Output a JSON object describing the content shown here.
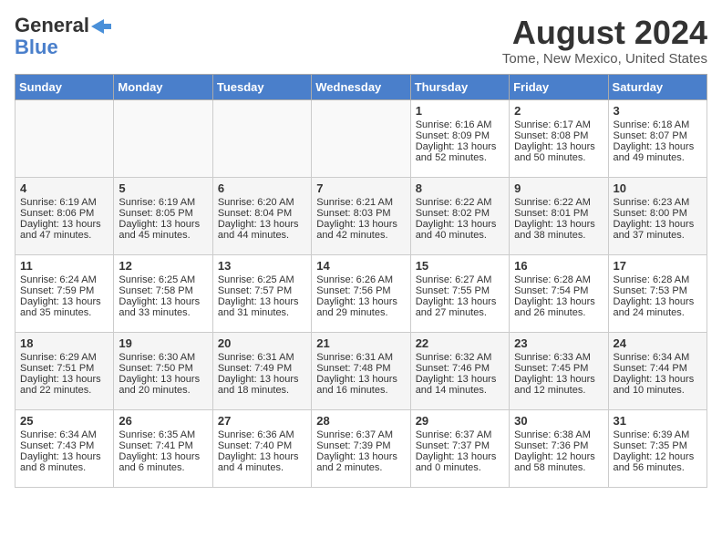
{
  "logo": {
    "line1": "General",
    "line2": "Blue"
  },
  "title": "August 2024",
  "location": "Tome, New Mexico, United States",
  "days_header": [
    "Sunday",
    "Monday",
    "Tuesday",
    "Wednesday",
    "Thursday",
    "Friday",
    "Saturday"
  ],
  "weeks": [
    [
      {
        "day": "",
        "info": ""
      },
      {
        "day": "",
        "info": ""
      },
      {
        "day": "",
        "info": ""
      },
      {
        "day": "",
        "info": ""
      },
      {
        "day": "1",
        "sunrise": "Sunrise: 6:16 AM",
        "sunset": "Sunset: 8:09 PM",
        "daylight": "Daylight: 13 hours and 52 minutes."
      },
      {
        "day": "2",
        "sunrise": "Sunrise: 6:17 AM",
        "sunset": "Sunset: 8:08 PM",
        "daylight": "Daylight: 13 hours and 50 minutes."
      },
      {
        "day": "3",
        "sunrise": "Sunrise: 6:18 AM",
        "sunset": "Sunset: 8:07 PM",
        "daylight": "Daylight: 13 hours and 49 minutes."
      }
    ],
    [
      {
        "day": "4",
        "sunrise": "Sunrise: 6:19 AM",
        "sunset": "Sunset: 8:06 PM",
        "daylight": "Daylight: 13 hours and 47 minutes."
      },
      {
        "day": "5",
        "sunrise": "Sunrise: 6:19 AM",
        "sunset": "Sunset: 8:05 PM",
        "daylight": "Daylight: 13 hours and 45 minutes."
      },
      {
        "day": "6",
        "sunrise": "Sunrise: 6:20 AM",
        "sunset": "Sunset: 8:04 PM",
        "daylight": "Daylight: 13 hours and 44 minutes."
      },
      {
        "day": "7",
        "sunrise": "Sunrise: 6:21 AM",
        "sunset": "Sunset: 8:03 PM",
        "daylight": "Daylight: 13 hours and 42 minutes."
      },
      {
        "day": "8",
        "sunrise": "Sunrise: 6:22 AM",
        "sunset": "Sunset: 8:02 PM",
        "daylight": "Daylight: 13 hours and 40 minutes."
      },
      {
        "day": "9",
        "sunrise": "Sunrise: 6:22 AM",
        "sunset": "Sunset: 8:01 PM",
        "daylight": "Daylight: 13 hours and 38 minutes."
      },
      {
        "day": "10",
        "sunrise": "Sunrise: 6:23 AM",
        "sunset": "Sunset: 8:00 PM",
        "daylight": "Daylight: 13 hours and 37 minutes."
      }
    ],
    [
      {
        "day": "11",
        "sunrise": "Sunrise: 6:24 AM",
        "sunset": "Sunset: 7:59 PM",
        "daylight": "Daylight: 13 hours and 35 minutes."
      },
      {
        "day": "12",
        "sunrise": "Sunrise: 6:25 AM",
        "sunset": "Sunset: 7:58 PM",
        "daylight": "Daylight: 13 hours and 33 minutes."
      },
      {
        "day": "13",
        "sunrise": "Sunrise: 6:25 AM",
        "sunset": "Sunset: 7:57 PM",
        "daylight": "Daylight: 13 hours and 31 minutes."
      },
      {
        "day": "14",
        "sunrise": "Sunrise: 6:26 AM",
        "sunset": "Sunset: 7:56 PM",
        "daylight": "Daylight: 13 hours and 29 minutes."
      },
      {
        "day": "15",
        "sunrise": "Sunrise: 6:27 AM",
        "sunset": "Sunset: 7:55 PM",
        "daylight": "Daylight: 13 hours and 27 minutes."
      },
      {
        "day": "16",
        "sunrise": "Sunrise: 6:28 AM",
        "sunset": "Sunset: 7:54 PM",
        "daylight": "Daylight: 13 hours and 26 minutes."
      },
      {
        "day": "17",
        "sunrise": "Sunrise: 6:28 AM",
        "sunset": "Sunset: 7:53 PM",
        "daylight": "Daylight: 13 hours and 24 minutes."
      }
    ],
    [
      {
        "day": "18",
        "sunrise": "Sunrise: 6:29 AM",
        "sunset": "Sunset: 7:51 PM",
        "daylight": "Daylight: 13 hours and 22 minutes."
      },
      {
        "day": "19",
        "sunrise": "Sunrise: 6:30 AM",
        "sunset": "Sunset: 7:50 PM",
        "daylight": "Daylight: 13 hours and 20 minutes."
      },
      {
        "day": "20",
        "sunrise": "Sunrise: 6:31 AM",
        "sunset": "Sunset: 7:49 PM",
        "daylight": "Daylight: 13 hours and 18 minutes."
      },
      {
        "day": "21",
        "sunrise": "Sunrise: 6:31 AM",
        "sunset": "Sunset: 7:48 PM",
        "daylight": "Daylight: 13 hours and 16 minutes."
      },
      {
        "day": "22",
        "sunrise": "Sunrise: 6:32 AM",
        "sunset": "Sunset: 7:46 PM",
        "daylight": "Daylight: 13 hours and 14 minutes."
      },
      {
        "day": "23",
        "sunrise": "Sunrise: 6:33 AM",
        "sunset": "Sunset: 7:45 PM",
        "daylight": "Daylight: 13 hours and 12 minutes."
      },
      {
        "day": "24",
        "sunrise": "Sunrise: 6:34 AM",
        "sunset": "Sunset: 7:44 PM",
        "daylight": "Daylight: 13 hours and 10 minutes."
      }
    ],
    [
      {
        "day": "25",
        "sunrise": "Sunrise: 6:34 AM",
        "sunset": "Sunset: 7:43 PM",
        "daylight": "Daylight: 13 hours and 8 minutes."
      },
      {
        "day": "26",
        "sunrise": "Sunrise: 6:35 AM",
        "sunset": "Sunset: 7:41 PM",
        "daylight": "Daylight: 13 hours and 6 minutes."
      },
      {
        "day": "27",
        "sunrise": "Sunrise: 6:36 AM",
        "sunset": "Sunset: 7:40 PM",
        "daylight": "Daylight: 13 hours and 4 minutes."
      },
      {
        "day": "28",
        "sunrise": "Sunrise: 6:37 AM",
        "sunset": "Sunset: 7:39 PM",
        "daylight": "Daylight: 13 hours and 2 minutes."
      },
      {
        "day": "29",
        "sunrise": "Sunrise: 6:37 AM",
        "sunset": "Sunset: 7:37 PM",
        "daylight": "Daylight: 13 hours and 0 minutes."
      },
      {
        "day": "30",
        "sunrise": "Sunrise: 6:38 AM",
        "sunset": "Sunset: 7:36 PM",
        "daylight": "Daylight: 12 hours and 58 minutes."
      },
      {
        "day": "31",
        "sunrise": "Sunrise: 6:39 AM",
        "sunset": "Sunset: 7:35 PM",
        "daylight": "Daylight: 12 hours and 56 minutes."
      }
    ]
  ]
}
